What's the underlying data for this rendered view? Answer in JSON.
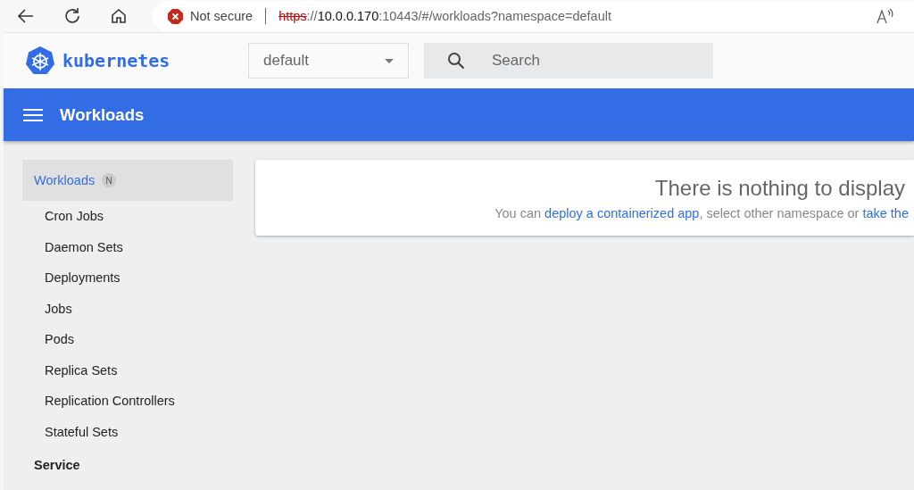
{
  "browser": {
    "security": "Not secure",
    "url": [
      {
        "text": "https",
        "kind": "struck"
      },
      {
        "text": "://",
        "kind": "dim"
      },
      {
        "text": "10.0.0.170",
        "kind": "host"
      },
      {
        "text": ":10443/#/workloads?namespace=default",
        "kind": "dim"
      }
    ]
  },
  "header": {
    "logo": "kubernetes",
    "namespace": "default",
    "search": {
      "placeholder": "Search"
    }
  },
  "toolbar": {
    "title": "Workloads"
  },
  "sidebar": {
    "items": [
      {
        "label": "Workloads",
        "badge": "N",
        "selected": true,
        "kind": "section"
      },
      {
        "label": "Cron Jobs",
        "selected": false,
        "kind": "sub"
      },
      {
        "label": "Daemon Sets",
        "selected": false,
        "kind": "sub"
      },
      {
        "label": "Deployments",
        "selected": false,
        "kind": "sub"
      },
      {
        "label": "Jobs",
        "selected": false,
        "kind": "sub"
      },
      {
        "label": "Pods",
        "selected": false,
        "kind": "sub"
      },
      {
        "label": "Replica Sets",
        "selected": false,
        "kind": "sub"
      },
      {
        "label": "Replication Controllers",
        "selected": false,
        "kind": "sub"
      },
      {
        "label": "Stateful Sets",
        "selected": false,
        "kind": "sub"
      },
      {
        "label": "Service",
        "selected": false,
        "kind": "section"
      }
    ]
  },
  "empty_state": {
    "title": "There is nothing to display",
    "message": [
      {
        "text": "You can ",
        "kind": "text"
      },
      {
        "text": "deploy a containerized app",
        "kind": "link"
      },
      {
        "text": ", select other namespace or ",
        "kind": "text"
      },
      {
        "text": "take the",
        "kind": "link"
      }
    ]
  }
}
